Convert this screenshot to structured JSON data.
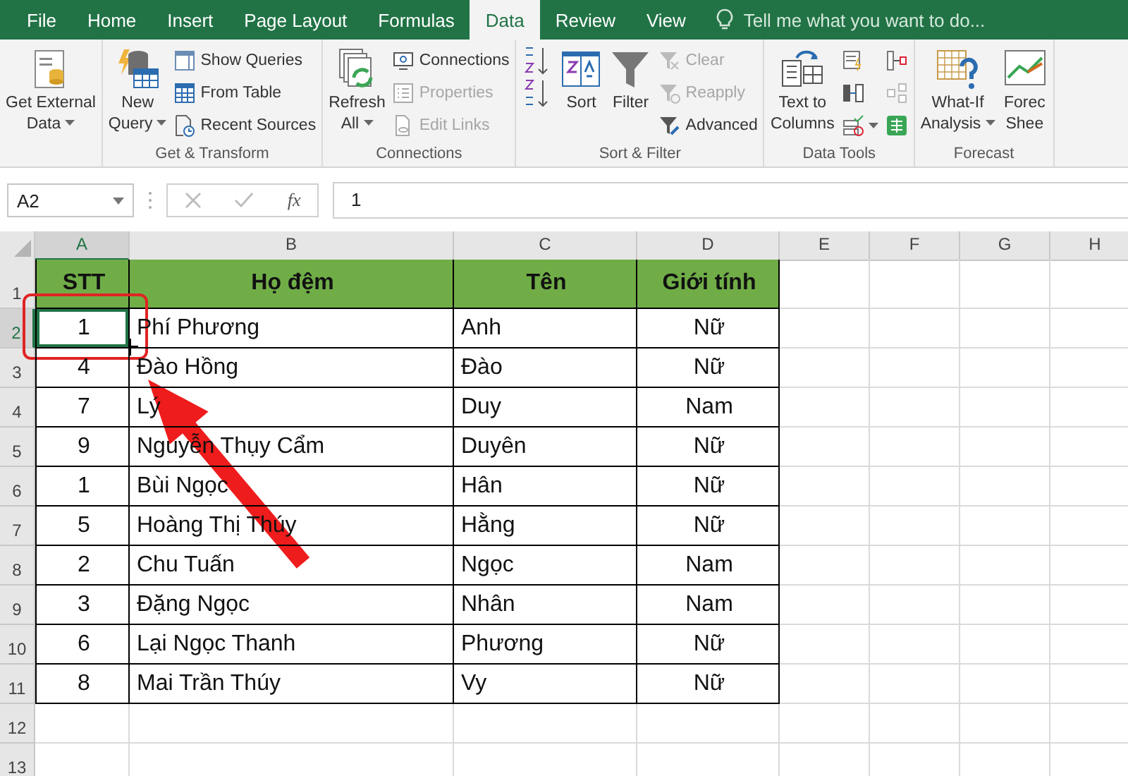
{
  "ribbon_tabs": [
    {
      "label": "File",
      "selected": false
    },
    {
      "label": "Home",
      "selected": false
    },
    {
      "label": "Insert",
      "selected": false
    },
    {
      "label": "Page Layout",
      "selected": false
    },
    {
      "label": "Formulas",
      "selected": false
    },
    {
      "label": "Data",
      "selected": true
    },
    {
      "label": "Review",
      "selected": false
    },
    {
      "label": "View",
      "selected": false
    }
  ],
  "tell_me": {
    "placeholder": "Tell me what you want to do..."
  },
  "ribbon_groups": [
    {
      "columns": [
        [
          {
            "kind": "large",
            "label": "Get External\nData",
            "dropdown": true
          }
        ]
      ]
    },
    {
      "label": "Get & Transform",
      "columns": [
        [
          {
            "kind": "large",
            "label": "New\nQuery",
            "dropdown": true
          }
        ],
        [
          {
            "kind": "small",
            "label": "Show Queries",
            "disabled": false
          },
          {
            "kind": "small",
            "label": "From Table",
            "disabled": false
          },
          {
            "kind": "small",
            "label": "Recent Sources",
            "disabled": false
          }
        ]
      ]
    },
    {
      "label": "Connections",
      "columns": [
        [
          {
            "kind": "large",
            "label": "Refresh\nAll",
            "dropdown": true
          }
        ],
        [
          {
            "kind": "small",
            "label": "Connections",
            "disabled": false
          },
          {
            "kind": "small",
            "label": "Properties",
            "disabled": true
          },
          {
            "kind": "small",
            "label": "Edit Links",
            "disabled": true
          }
        ]
      ]
    },
    {
      "label": "Sort & Filter",
      "columns": [
        [
          {
            "kind": "icon"
          },
          {
            "kind": "icon"
          }
        ],
        [
          {
            "kind": "large",
            "label": "Sort"
          }
        ],
        [
          {
            "kind": "large",
            "label": "Filter"
          }
        ],
        [
          {
            "kind": "small",
            "label": "Clear",
            "disabled": true
          },
          {
            "kind": "small",
            "label": "Reapply",
            "disabled": true
          },
          {
            "kind": "small",
            "label": "Advanced",
            "disabled": false
          }
        ]
      ]
    },
    {
      "label": "Data Tools",
      "columns": [
        [
          {
            "kind": "large",
            "label": "Text to\nColumns"
          }
        ],
        [
          {
            "kind": "icon"
          },
          {
            "kind": "icon"
          },
          {
            "kind": "icon",
            "dropdown": true
          }
        ],
        [
          {
            "kind": "icon"
          },
          {
            "kind": "icon"
          },
          {
            "kind": "icon"
          }
        ]
      ]
    },
    {
      "label": "Forecast",
      "columns": [
        [
          {
            "kind": "large",
            "label": "What-If\nAnalysis",
            "dropdown": true
          }
        ],
        [
          {
            "kind": "large",
            "label": "Forec\nShee"
          }
        ]
      ]
    }
  ],
  "formula_bar": {
    "name_box": "A2",
    "function_label": "fx",
    "value": "1"
  },
  "columns": [
    {
      "label": "A",
      "selected": true
    },
    {
      "label": "B",
      "selected": false
    },
    {
      "label": "C",
      "selected": false
    },
    {
      "label": "D",
      "selected": false
    },
    {
      "label": "E",
      "selected": false
    },
    {
      "label": "F",
      "selected": false
    },
    {
      "label": "G",
      "selected": false
    },
    {
      "label": "H",
      "selected": false
    }
  ],
  "rows": [
    {
      "number": "1",
      "kind": "header",
      "selected": false,
      "cells": [
        "STT",
        "Họ đệm",
        "Tên",
        "Giới tính"
      ]
    },
    {
      "number": "2",
      "kind": "data",
      "selected": true,
      "cells": [
        "1",
        "Phí Phương",
        "Anh",
        "Nữ"
      ]
    },
    {
      "number": "3",
      "kind": "data",
      "selected": false,
      "cells": [
        "4",
        "Đào Hồng",
        "Đào",
        "Nữ"
      ]
    },
    {
      "number": "4",
      "kind": "data",
      "selected": false,
      "cells": [
        "7",
        "Lý",
        "Duy",
        "Nam"
      ]
    },
    {
      "number": "5",
      "kind": "data",
      "selected": false,
      "cells": [
        "9",
        "Nguyễn Thụy Cẩm",
        "Duyên",
        "Nữ"
      ]
    },
    {
      "number": "6",
      "kind": "data",
      "selected": false,
      "cells": [
        "1",
        "Bùi Ngọc",
        "Hân",
        "Nữ"
      ]
    },
    {
      "number": "7",
      "kind": "data",
      "selected": false,
      "cells": [
        "5",
        "Hoàng Thị Thúy",
        "Hằng",
        "Nữ"
      ]
    },
    {
      "number": "8",
      "kind": "data",
      "selected": false,
      "cells": [
        "2",
        "Chu Tuấn",
        "Ngọc",
        "Nam"
      ]
    },
    {
      "number": "9",
      "kind": "data",
      "selected": false,
      "cells": [
        "3",
        "Đặng Ngọc",
        "Nhân",
        "Nam"
      ]
    },
    {
      "number": "10",
      "kind": "data",
      "selected": false,
      "cells": [
        "6",
        "Lại Ngọc Thanh",
        "Phương",
        "Nữ"
      ]
    },
    {
      "number": "11",
      "kind": "data",
      "selected": false,
      "cells": [
        "8",
        "Mai Trần Thúy",
        "Vy",
        "Nữ"
      ]
    },
    {
      "number": "12",
      "kind": "empty",
      "selected": false,
      "cells": []
    },
    {
      "number": "13",
      "kind": "empty",
      "selected": false,
      "cells": []
    }
  ]
}
